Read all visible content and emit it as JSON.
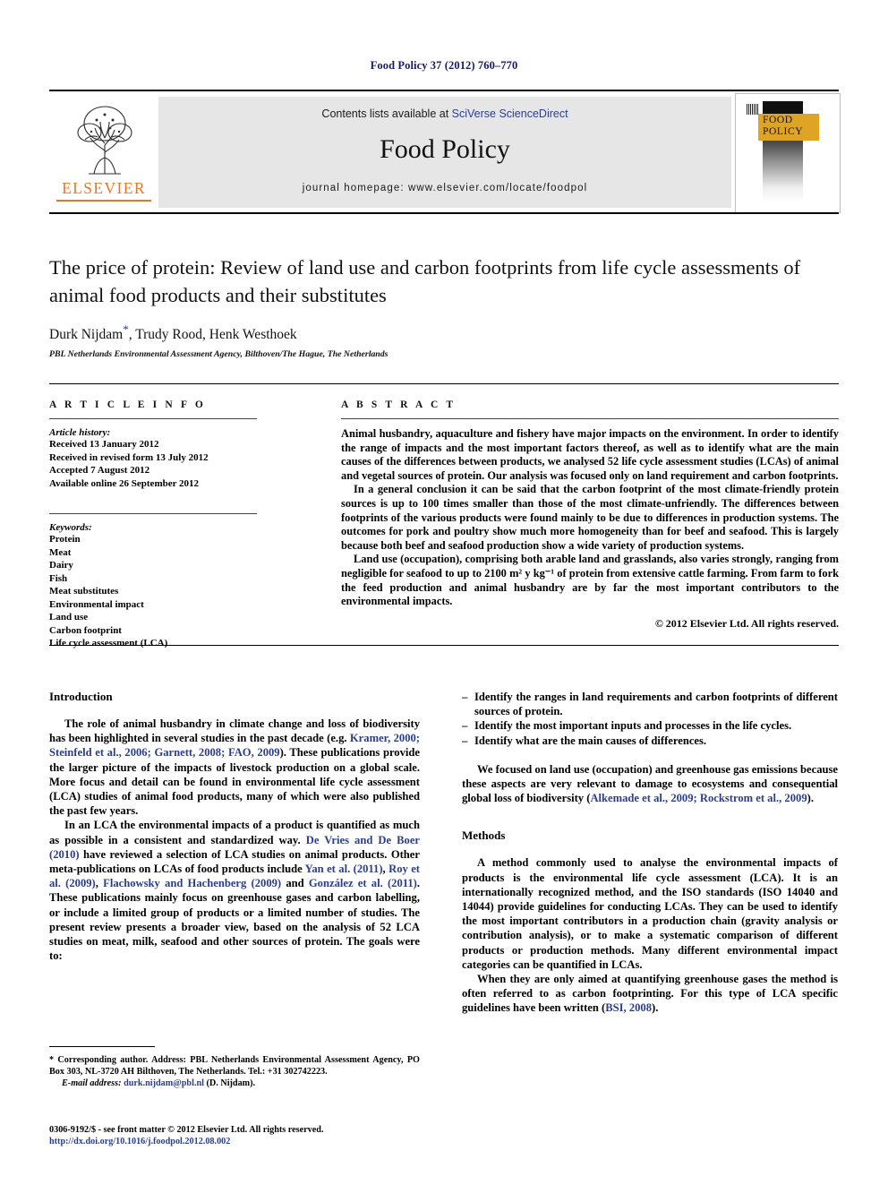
{
  "running_head": "Food Policy 37 (2012) 760–770",
  "masthead": {
    "contents_prefix": "Contents lists available at ",
    "contents_link": "SciVerse ScienceDirect",
    "journal_title": "Food Policy",
    "homepage": "journal homepage: www.elsevier.com/locate/foodpol",
    "publisher_name": "ELSEVIER",
    "cover": {
      "line1": "FOOD",
      "line2": "POLICY"
    }
  },
  "title_block": {
    "title": "The price of protein: Review of land use and carbon footprints from life cycle assessments of animal food products and their substitutes",
    "authors": "Durk Nijdam",
    "corresponding_marker": "*",
    "authors_rest": ", Trudy Rood, Henk Westhoek",
    "affiliation": "PBL Netherlands Environmental Assessment Agency, Bilthoven/The Hague, The Netherlands"
  },
  "article_info": {
    "heading": "A R T I C L E   I N F O",
    "history_label": "Article history:",
    "history": [
      "Received 13 January 2012",
      "Received in revised form 13 July 2012",
      "Accepted 7 August 2012",
      "Available online 26 September 2012"
    ],
    "keywords_label": "Keywords:",
    "keywords": [
      "Protein",
      "Meat",
      "Dairy",
      "Fish",
      "Meat substitutes",
      "Environmental impact",
      "Land use",
      "Carbon footprint",
      "Life cycle assessment (LCA)"
    ]
  },
  "abstract": {
    "heading": "A B S T R A C T",
    "paragraphs": [
      "Animal husbandry, aquaculture and fishery have major impacts on the environment. In order to identify the range of impacts and the most important factors thereof, as well as to identify what are the main causes of the differences between products, we analysed 52 life cycle assessment studies (LCAs) of animal and vegetal sources of protein. Our analysis was focused only on land requirement and carbon footprints.",
      "In a general conclusion it can be said that the carbon footprint of the most climate-friendly protein sources is up to 100 times smaller than those of the most climate-unfriendly. The differences between footprints of the various products were found mainly to be due to differences in production systems. The outcomes for pork and poultry show much more homogeneity than for beef and seafood. This is largely because both beef and seafood production show a wide variety of production systems.",
      "Land use (occupation), comprising both arable land and grasslands, also varies strongly, ranging from negligible for seafood to up to 2100 m² y kg⁻¹ of protein from extensive cattle farming. From farm to fork the feed production and animal husbandry are by far the most important contributors to the environmental impacts."
    ],
    "copyright": "© 2012 Elsevier Ltd. All rights reserved."
  },
  "body": {
    "introduction": {
      "heading": "Introduction",
      "p1_a": "The role of animal husbandry in climate change and loss of biodiversity has been highlighted in several studies in the past decade (e.g. ",
      "p1_cite": "Kramer, 2000; Steinfeld et al., 2006; Garnett, 2008; FAO, 2009",
      "p1_b": "). These publications provide the larger picture of the impacts of livestock production on a global scale. More focus and detail can be found in environmental life cycle assessment (LCA) studies of animal food products, many of which were also published the past few years.",
      "p2_a": "In an LCA the environmental impacts of a product is quantified as much as possible in a consistent and standardized way. ",
      "p2_cite1": "De Vries and De Boer (2010)",
      "p2_b": " have reviewed a selection of LCA studies on animal products. Other meta-publications on LCAs of food products include ",
      "p2_cite2": "Yan et al. (2011)",
      "p2_c": ", ",
      "p2_cite3": "Roy et al. (2009)",
      "p2_d": ", ",
      "p2_cite4": "Flachowsky and Hachenberg (2009)",
      "p2_e": " and ",
      "p2_cite5": "González et al. (2011)",
      "p2_f": ". These publications mainly focus on greenhouse gases and carbon labelling, or include a limited group of products or a limited number of studies. The present review presents a broader view, based on the analysis of 52 LCA studies on meat, milk, seafood and other sources of protein. The goals were to:"
    },
    "goals": [
      "Identify the ranges in land requirements and carbon footprints of different sources of protein.",
      "Identify the most important inputs and processes in the life cycles.",
      "Identify what are the main causes of differences."
    ],
    "goals_dash": "–",
    "focus_paragraph": {
      "a": "We focused on land use (occupation) and greenhouse gas emissions because these aspects are very relevant to damage to ecosystems and consequential global loss of biodiversity (",
      "cite": "Alkemade et al., 2009; Rockstrom et al., 2009",
      "b": ")."
    },
    "methods": {
      "heading": "Methods",
      "p1": "A method commonly used to analyse the environmental impacts of products is the environmental life cycle assessment (LCA). It is an internationally recognized method, and the ISO standards (ISO 14040 and 14044) provide guidelines for conducting LCAs. They can be used to identify the most important contributors in a production chain (gravity analysis or contribution analysis), or to make a systematic comparison of different products or production methods. Many different environmental impact categories can be quantified in LCAs.",
      "p2_a": "When they are only aimed at quantifying greenhouse gases the method is often referred to as carbon footprinting. For this type of LCA specific guidelines have been written (",
      "p2_cite": "BSI, 2008",
      "p2_b": ")."
    }
  },
  "footnotes": {
    "corresponding": "* Corresponding author. Address: PBL Netherlands Environmental Assessment Agency, PO Box 303, NL-3720 AH Bilthoven, The Netherlands. Tel.: +31 302742223.",
    "email_label": "E-mail address:",
    "email": "durk.nijdam@pbl.nl",
    "email_suffix": " (D. Nijdam).",
    "issn": "0306-9192/$ - see front matter © 2012 Elsevier Ltd. All rights reserved.",
    "doi": "http://dx.doi.org/10.1016/j.foodpol.2012.08.002"
  },
  "colors": {
    "link": "#2b3e8c",
    "running_head": "#1a1a63",
    "elsevier_orange": "#e87722",
    "masthead_bg": "#e6e6e6",
    "cover_yellow": "#e0a424"
  }
}
